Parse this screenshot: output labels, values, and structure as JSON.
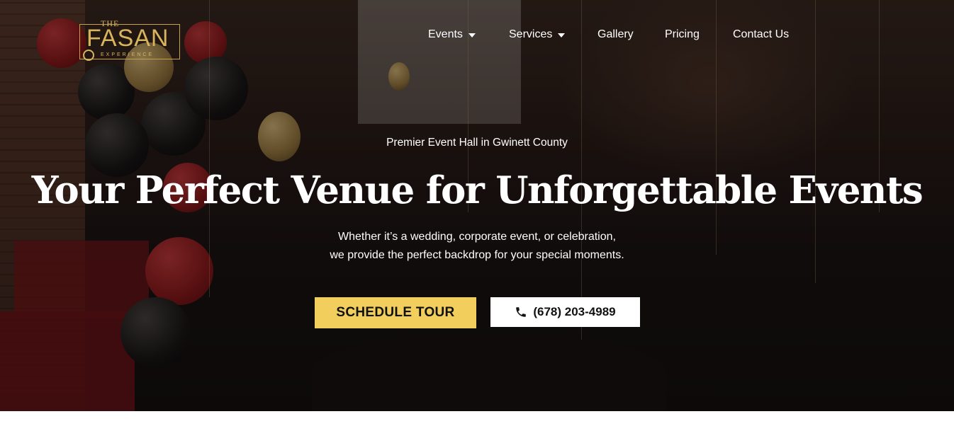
{
  "logo": {
    "top_text": "THE",
    "main_text": "FASAN",
    "sub_text": "EXPERIENCE"
  },
  "nav": {
    "items": [
      {
        "label": "Events",
        "has_dropdown": true
      },
      {
        "label": "Services",
        "has_dropdown": true
      },
      {
        "label": "Gallery",
        "has_dropdown": false
      },
      {
        "label": "Pricing",
        "has_dropdown": false
      },
      {
        "label": "Contact Us",
        "has_dropdown": false
      }
    ]
  },
  "hero": {
    "eyebrow": "Premier Event Hall in Gwinett County",
    "headline": "Your Perfect Venue for Unforgettable Events",
    "subtitle_line1": "Whether it’s a wedding, corporate event, or celebration,",
    "subtitle_line2": "we provide the perfect backdrop for your special moments.",
    "cta_primary": "SCHEDULE TOUR",
    "cta_phone": "(678) 203-4989",
    "phone_icon": "phone-icon"
  },
  "colors": {
    "accent": "#f2cf5c",
    "logo_gold": "#d8b45c",
    "text": "#ffffff"
  }
}
